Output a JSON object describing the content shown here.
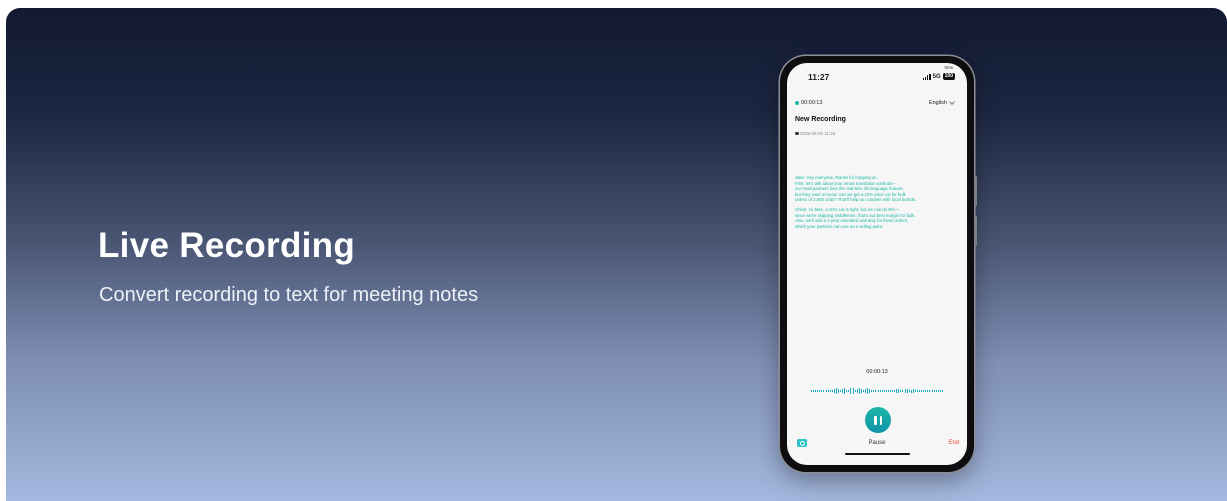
{
  "hero": {
    "title": "Live Recording",
    "subtitle": "Convert recording to text for meeting notes"
  },
  "phone": {
    "status_bar": {
      "time": "11:27",
      "network_speed": "0ms",
      "signal": "5G",
      "battery": "100"
    },
    "recording": {
      "elapsed": "00:00:13",
      "language": "English",
      "title": "New Recording",
      "date": "2025-09-02 11:26"
    },
    "transcript": [
      {
        "lines": [
          "Jake:  Hey everyone, thanks for hopping on.",
          "First, let's talk about your smart translation earbuds—",
          "our retail partners love the real-time 30-language feature,",
          "but they want to know: can we get a 10% price cut for bulk",
          "orders of 2,000 units? That'll help us compete with local brands."
        ]
      },
      {
        "lines": [
          "Chloe:  Hi Jake, a 10% cut is tight, but we can do 8%—",
          "since we're skipping middlemen, that's our best margin for bulk.",
          "Also, we'll add a 1-year extended warranty for these orders,",
          "which your partners can use as a selling point."
        ]
      }
    ],
    "controls": {
      "timer": "00:00:13",
      "pause_label": "Pause",
      "end_label": "End"
    }
  },
  "colors": {
    "accent_teal": "#16b8a6",
    "end_red": "#e84b3b",
    "banner_top": "#121a32",
    "banner_bottom": "#a3b8de"
  },
  "icons": [
    "camera-icon",
    "pause-icon",
    "chevron-down-icon",
    "signal-icon",
    "battery-icon"
  ]
}
